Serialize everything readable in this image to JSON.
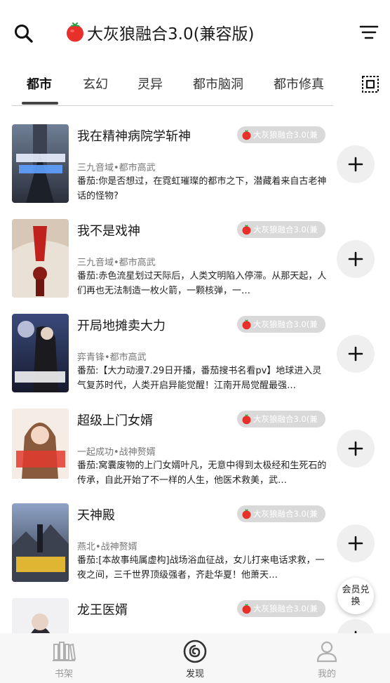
{
  "header": {
    "title": "大灰狼融合3.0(兼容版)",
    "search_icon": "search-icon",
    "filter_icon": "filter-icon"
  },
  "tabs": [
    {
      "label": "都市",
      "active": true
    },
    {
      "label": "玄幻",
      "active": false
    },
    {
      "label": "灵异",
      "active": false
    },
    {
      "label": "都市脑洞",
      "active": false
    },
    {
      "label": "都市修真",
      "active": false
    }
  ],
  "books": [
    {
      "title": "我在精神病院学斩神",
      "source": "大灰狼融合3.0(兼",
      "meta": "三九音域•都市高武",
      "desc": "番茄:你是否想过，在霓虹璀璨的都市之下，潜藏着来自古老神话的怪物?"
    },
    {
      "title": "我不是戏神",
      "source": "大灰狼融合3.0(兼",
      "meta": "三九音域•都市高武",
      "desc": "番茄:赤色流星划过天际后，人类文明陷入停滞。从那天起，人们再也无法制造一枚火箭，一颗核弹，一…"
    },
    {
      "title": "开局地摊卖大力",
      "source": "大灰狼融合3.0(兼",
      "meta": "弈青锋•都市高武",
      "desc": "番茄:【大力动漫7.29日开播，番茄搜书名看pv】地球进入灵气复苏时代，人类开启异能觉醒！江南开局觉醒最强…"
    },
    {
      "title": "超级上门女婿",
      "source": "大灰狼融合3.0(兼",
      "meta": "一起成功•战神赘婿",
      "desc": "番茄:窝囊废物的上门女婿叶凡，无意中得到太极经和生死石的传承，自此开始了不一样的人生，他医术救美，武…"
    },
    {
      "title": "天神殿",
      "source": "大灰狼融合3.0(兼",
      "meta": "燕北•战神赘婿",
      "desc": "番茄:[本故事纯属虚构]战场浴血征战，女儿打来电话求救，一夜之间，三千世界顶级强者，齐赴华夏！他萧天…"
    },
    {
      "title": "龙王医婿",
      "source": "大灰狼融合3.0(兼",
      "meta": "",
      "desc": ""
    }
  ],
  "vip": {
    "label": "会员兑换"
  },
  "nav": [
    {
      "label": "书架",
      "icon": "bookshelf-icon",
      "active": false
    },
    {
      "label": "发现",
      "icon": "discover-icon",
      "active": true
    },
    {
      "label": "我的",
      "icon": "profile-icon",
      "active": false
    }
  ],
  "colors": {
    "tag_bg": "#d9d9d9",
    "tomato_red": "#e8302a",
    "tab_underline": "#444444"
  }
}
